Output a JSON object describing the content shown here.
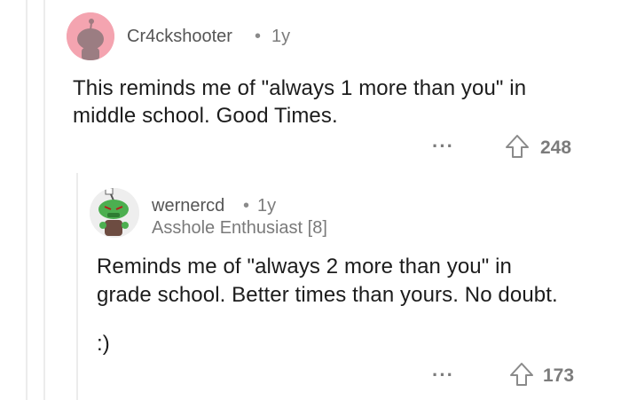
{
  "comment": {
    "username": "Cr4ckshooter",
    "separator": "•",
    "age": "1y",
    "body_lines": [
      "This reminds me of \"always 1 more than you\" in",
      "middle school. Good Times."
    ],
    "more_label": "···",
    "score": "248",
    "avatar_color": "#f4a4b0"
  },
  "reply": {
    "username": "wernercd",
    "separator": "•",
    "age": "1y",
    "flair": "Asshole Enthusiast [8]",
    "body_lines": [
      "Reminds me of \"always 2 more than you\" in",
      "grade school. Better times than yours. No doubt."
    ],
    "body_extra": ":)",
    "more_label": "···",
    "score": "173",
    "avatar_color": "#4caf50"
  }
}
